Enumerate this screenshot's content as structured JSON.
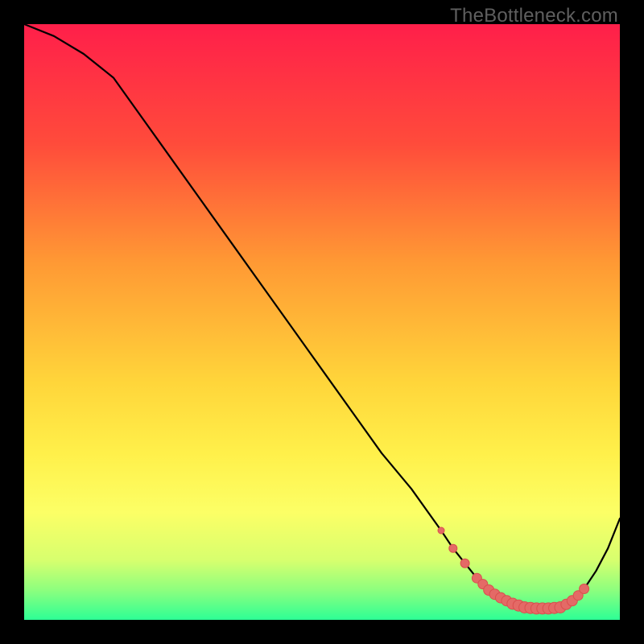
{
  "watermark": "TheBottleneck.com",
  "colors": {
    "gradient_stops": [
      {
        "offset": 0.0,
        "color": "#ff1f4a"
      },
      {
        "offset": 0.2,
        "color": "#ff4b3b"
      },
      {
        "offset": 0.4,
        "color": "#ff9934"
      },
      {
        "offset": 0.6,
        "color": "#ffd53a"
      },
      {
        "offset": 0.72,
        "color": "#fff04a"
      },
      {
        "offset": 0.82,
        "color": "#fcff66"
      },
      {
        "offset": 0.9,
        "color": "#d7ff6e"
      },
      {
        "offset": 0.95,
        "color": "#8dff7e"
      },
      {
        "offset": 1.0,
        "color": "#2dff95"
      }
    ],
    "curve": "#000000",
    "dot_fill": "#e46a66",
    "dot_stroke": "#d94f4e"
  },
  "chart_data": {
    "type": "line",
    "title": "",
    "xlabel": "",
    "ylabel": "",
    "xlim": [
      0,
      100
    ],
    "ylim": [
      0,
      100
    ],
    "grid": false,
    "legend": false,
    "series": [
      {
        "name": "bottleneck-curve",
        "x": [
          0,
          5,
          10,
          15,
          20,
          25,
          30,
          35,
          40,
          45,
          50,
          55,
          60,
          65,
          70,
          72,
          74,
          76,
          78,
          80,
          82,
          84,
          86,
          88,
          90,
          92,
          94,
          96,
          98,
          100
        ],
        "y": [
          100,
          98,
          95,
          91,
          84,
          77,
          70,
          63,
          56,
          49,
          42,
          35,
          28,
          22,
          15,
          12,
          9.5,
          7,
          5,
          3.7,
          2.7,
          2.1,
          1.9,
          1.9,
          2.1,
          3.2,
          5.2,
          8.2,
          12,
          17
        ]
      }
    ],
    "highlight_points": {
      "name": "optimal-zone",
      "x": [
        70,
        72,
        74,
        76,
        77,
        78,
        79,
        80,
        81,
        82,
        83,
        84,
        85,
        86,
        87,
        88,
        89,
        90,
        91,
        92,
        93,
        94
      ],
      "y": [
        15,
        12,
        9.5,
        7,
        6,
        5,
        4.3,
        3.7,
        3.2,
        2.7,
        2.4,
        2.1,
        2.0,
        1.9,
        1.9,
        1.9,
        2.0,
        2.1,
        2.6,
        3.2,
        4.1,
        5.2
      ],
      "r": [
        4,
        5,
        5.5,
        6,
        6,
        6.5,
        6.5,
        6.5,
        6.5,
        7,
        7,
        7,
        7,
        7,
        7,
        7,
        7,
        7,
        6.5,
        6.5,
        6,
        6
      ]
    }
  }
}
